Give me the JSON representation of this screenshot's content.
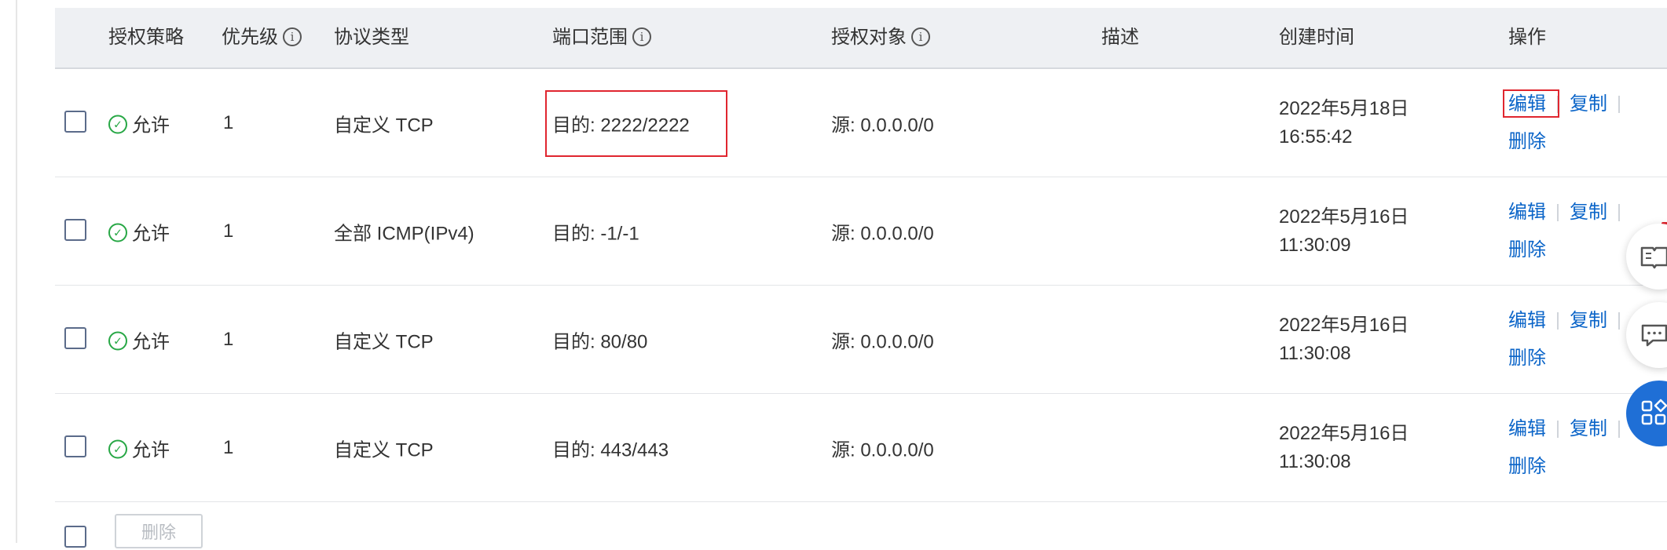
{
  "table": {
    "headers": {
      "policy": "授权策略",
      "priority": "优先级",
      "protocol": "协议类型",
      "port_range": "端口范围",
      "auth_object": "授权对象",
      "description": "描述",
      "created_time": "创建时间",
      "actions": "操作"
    },
    "rows": [
      {
        "policy": "允许",
        "priority": "1",
        "protocol": "自定义 TCP",
        "port_range": "目的: 2222/2222",
        "auth_object": "源: 0.0.0.0/0",
        "description": "",
        "date": "2022年5月18日",
        "time": "16:55:42",
        "highlighted": true
      },
      {
        "policy": "允许",
        "priority": "1",
        "protocol": "全部 ICMP(IPv4)",
        "port_range": "目的: -1/-1",
        "auth_object": "源: 0.0.0.0/0",
        "description": "",
        "date": "2022年5月16日",
        "time": "11:30:09",
        "highlighted": false
      },
      {
        "policy": "允许",
        "priority": "1",
        "protocol": "自定义 TCP",
        "port_range": "目的: 80/80",
        "auth_object": "源: 0.0.0.0/0",
        "description": "",
        "date": "2022年5月16日",
        "time": "11:30:08",
        "highlighted": false
      },
      {
        "policy": "允许",
        "priority": "1",
        "protocol": "自定义 TCP",
        "port_range": "目的: 443/443",
        "auth_object": "源: 0.0.0.0/0",
        "description": "",
        "date": "2022年5月16日",
        "time": "11:30:08",
        "highlighted": false
      }
    ],
    "actions": {
      "edit": "编辑",
      "copy": "复制",
      "delete": "删除"
    }
  },
  "footer": {
    "delete_button": "删除"
  },
  "floating_buttons": [
    {
      "name": "docs-icon"
    },
    {
      "name": "chat-icon"
    },
    {
      "name": "apps-icon"
    }
  ],
  "colors": {
    "link": "#0a64c8",
    "allow_green": "#27a745",
    "highlight_red": "#e0262f",
    "header_bg": "#eef0f3",
    "float_blue": "#1f6fd6"
  }
}
